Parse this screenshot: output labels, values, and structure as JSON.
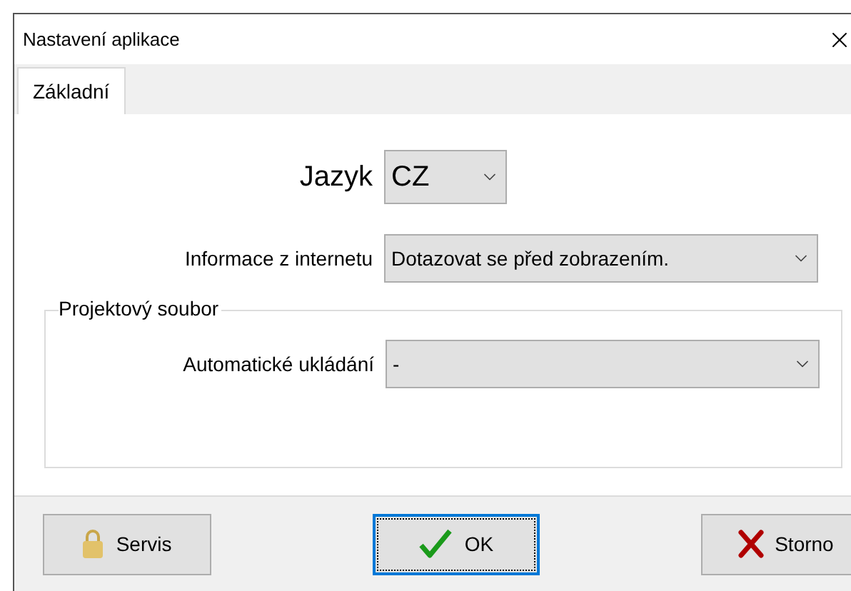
{
  "window": {
    "title": "Nastavení aplikace"
  },
  "tabs": [
    {
      "label": "Základní",
      "selected": true
    }
  ],
  "language": {
    "label": "Jazyk",
    "value": "CZ"
  },
  "internet_info": {
    "label": "Informace z internetu",
    "value": "Dotazovat se před zobrazením."
  },
  "project_file": {
    "title": "Projektový soubor",
    "autosave": {
      "label": "Automatické ukládání",
      "value": "-"
    }
  },
  "buttons": [
    {
      "label": "Servis",
      "kind": "lock",
      "focused": false
    },
    {
      "label": "OK",
      "kind": "check",
      "focused": true
    },
    {
      "label": "Storno",
      "kind": "cross",
      "focused": false
    }
  ]
}
